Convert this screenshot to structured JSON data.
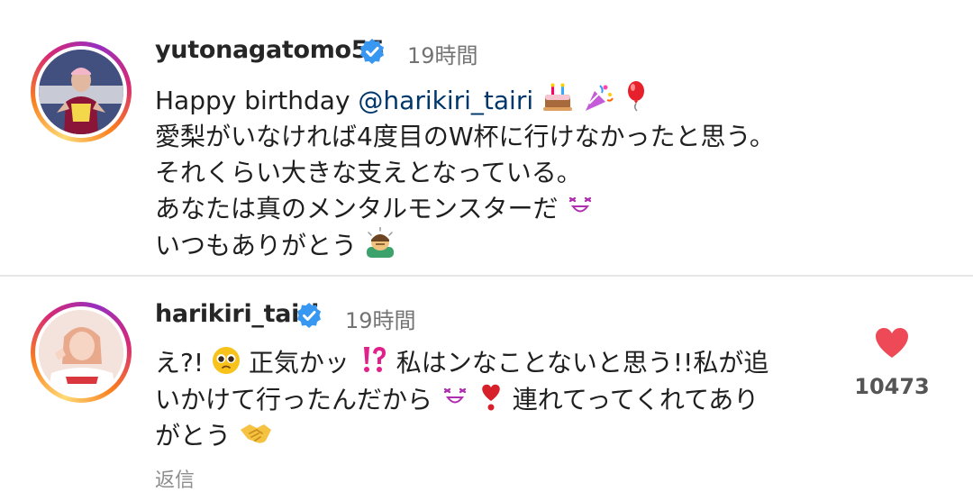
{
  "comments": [
    {
      "username": "yutonagatomo55",
      "time": "19時間",
      "lines": [
        {
          "mention_prefix": "Happy birthday ",
          "mention": "@harikiri_tairi"
        },
        {
          "text": "愛梨がいなければ4度目のW杯に行けなかったと思う。"
        },
        {
          "text": "それくらい大きな支えとなっている。"
        },
        {
          "text": "あなたは真のメンタルモンスターだ"
        },
        {
          "text": "いつもありがとう"
        }
      ]
    },
    {
      "username": "harikiri_tairi",
      "time": "19時間",
      "line1_a": "え?!",
      "line1_b": "正気かッ",
      "line1_c": "私はンなことないと思う!!私が追",
      "line2_a": "いかけて行ったんだから",
      "line2_b": "連れてってくれてあり",
      "line3_a": "がとう",
      "like_count": "10473",
      "reply_label": "返信"
    }
  ],
  "icons": [
    "verified-badge-icon",
    "cake-icon",
    "party-popper-icon",
    "balloon-icon",
    "grinning-face-icon",
    "person-bowing-icon",
    "pleading-face-icon",
    "interrobang-icon",
    "heart-exclamation-icon",
    "handshake-icon",
    "like-heart-icon"
  ],
  "colors": {
    "verified": "#3897f0",
    "like": "#ed4956",
    "mention": "#00376b"
  }
}
